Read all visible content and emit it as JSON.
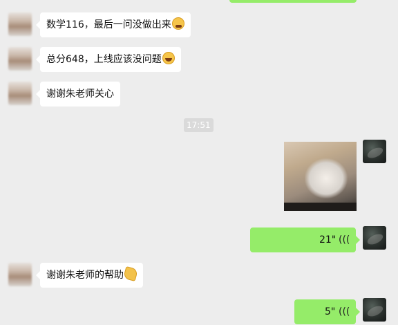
{
  "messages": [
    {
      "text": "数学116，最后一问没做出来",
      "emoji": "wipe-sweat-icon"
    },
    {
      "text": "总分648，上线应该没问题",
      "emoji": "laugh-cry-icon"
    },
    {
      "text": "谢谢朱老师关心"
    },
    {
      "text": "谢谢朱老师的帮助",
      "emoji": "pray-icon"
    }
  ],
  "timestamp": "17:51",
  "voice": [
    {
      "duration": "21\""
    },
    {
      "duration": "5\""
    }
  ],
  "colors": {
    "background": "#ededed",
    "own_bubble": "#95ec69",
    "other_bubble": "#ffffff"
  }
}
